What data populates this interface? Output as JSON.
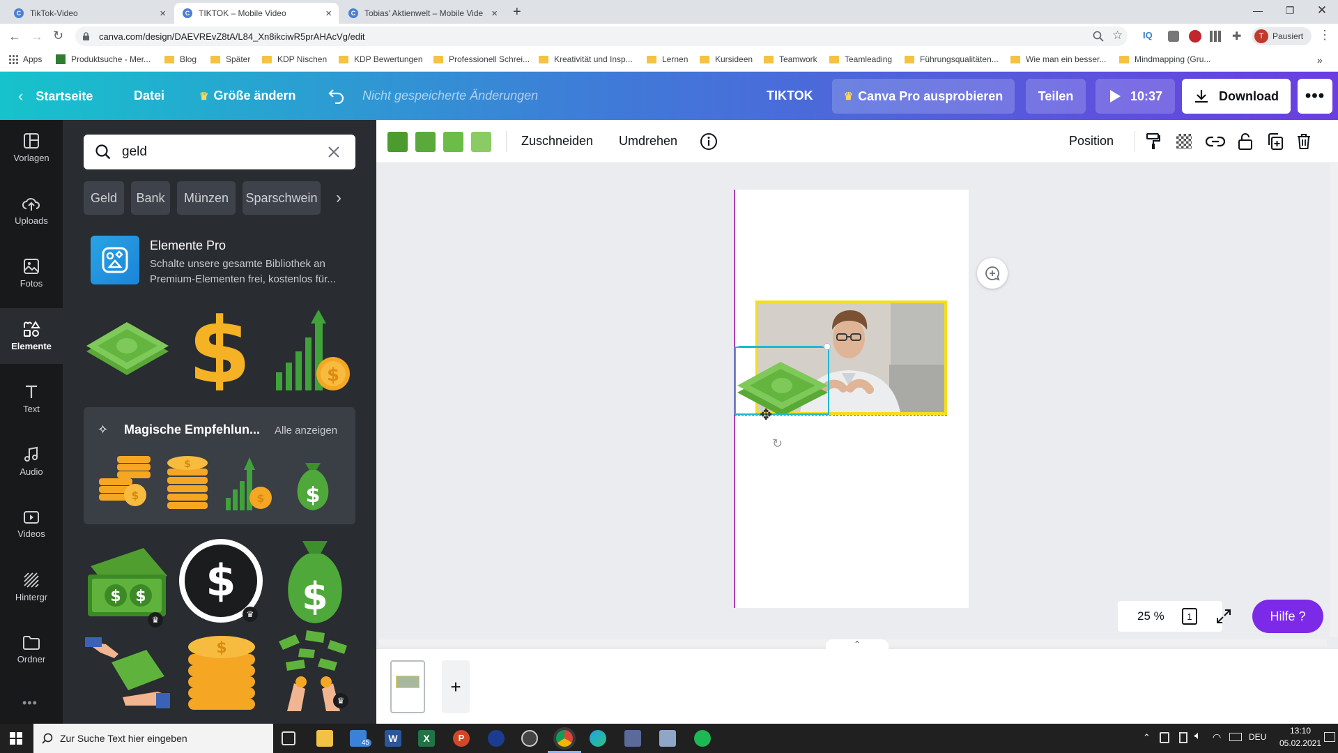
{
  "browser": {
    "tabs": [
      {
        "title": "TikTok-Video",
        "active": false
      },
      {
        "title": "TIKTOK – Mobile Video",
        "active": true
      },
      {
        "title": "Tobias' Aktienwelt – Mobile Vide",
        "active": false
      }
    ],
    "url": "canva.com/design/DAEVREvZ8tA/L84_Xn8ikciwR5prAHAcVg/edit",
    "profile_label": "Pausiert",
    "profile_initial": "T",
    "iq_label": "IQ",
    "bookmarks": [
      "Apps",
      "Produktsuche - Mer...",
      "Blog",
      "Später",
      "KDP Nischen",
      "KDP Bewertungen",
      "Professionell Schrei...",
      "Kreativität und Insp...",
      "Lernen",
      "Kursideen",
      "Teamwork",
      "Teamleading",
      "Führungsqualitäten...",
      "Wie man ein besser...",
      "Mindmapping (Gru..."
    ]
  },
  "header": {
    "home": "Startseite",
    "file": "Datei",
    "resize": "Größe ändern",
    "status": "Nicht gespeicherte Änderungen",
    "design_title": "TIKTOK",
    "pro": "Canva Pro ausprobieren",
    "share": "Teilen",
    "play_time": "10:37",
    "download": "Download"
  },
  "nav": [
    {
      "label": "Vorlagen",
      "icon": "templates-icon"
    },
    {
      "label": "Uploads",
      "icon": "upload-icon"
    },
    {
      "label": "Fotos",
      "icon": "photo-icon"
    },
    {
      "label": "Elemente",
      "icon": "elements-icon"
    },
    {
      "label": "Text",
      "icon": "text-icon"
    },
    {
      "label": "Audio",
      "icon": "audio-icon"
    },
    {
      "label": "Videos",
      "icon": "video-icon"
    },
    {
      "label": "Hintergr",
      "icon": "background-icon"
    },
    {
      "label": "Ordner",
      "icon": "folder-icon"
    }
  ],
  "panel": {
    "search_value": "geld",
    "chips": [
      "Geld",
      "Bank",
      "Münzen",
      "Sparschwein"
    ],
    "promo_title": "Elemente Pro",
    "promo_text": "Schalte unsere gesamte Bibliothek an Premium-Elementen frei, kostenlos für...",
    "magic_title": "Magische Empfehlun...",
    "see_all": "Alle anzeigen"
  },
  "toolbar": {
    "colors": [
      "#4b9b2e",
      "#5aaa3b",
      "#6cbc48",
      "#8acc63"
    ],
    "crop": "Zuschneiden",
    "flip": "Umdrehen",
    "position": "Position"
  },
  "canvas": {
    "zoom": "25 %",
    "page_count": "1",
    "help": "Hilfe ?"
  },
  "taskbar": {
    "search_placeholder": "Zur Suche Text hier eingeben",
    "mail_badge": "45",
    "lang": "DEU",
    "time": "13:10",
    "date": "05.02.2021"
  }
}
